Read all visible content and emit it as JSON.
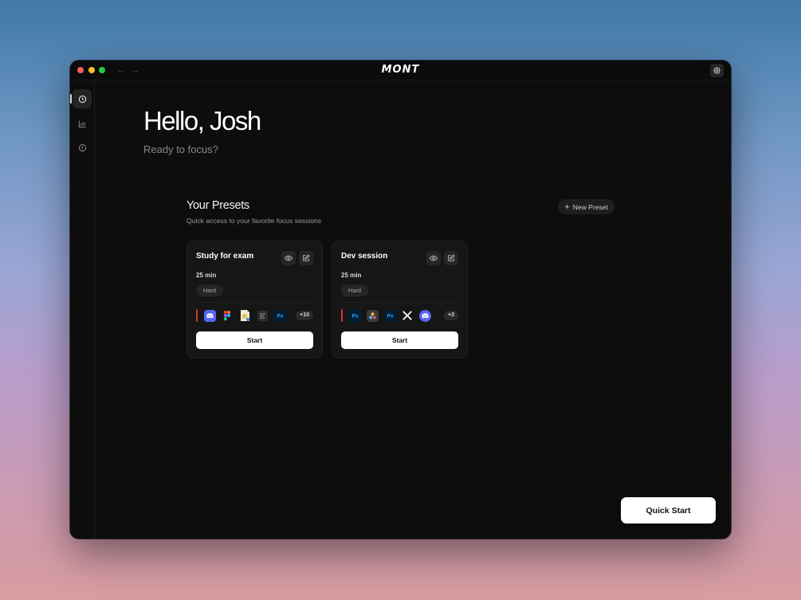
{
  "window": {
    "brand": "MONT",
    "traffic_lights": [
      "#fe5f57",
      "#febc2e",
      "#28c840"
    ],
    "nav": {
      "back_icon": "arrow-left-icon",
      "forward_icon": "arrow-right-icon"
    },
    "settings_icon": "gear-icon"
  },
  "sidebar": {
    "items": [
      {
        "icon": "clock-icon",
        "active": true
      },
      {
        "icon": "bar-chart-icon",
        "active": false
      },
      {
        "icon": "history-icon",
        "active": false
      }
    ]
  },
  "main": {
    "greeting": "Hello, Josh",
    "subtitle": "Ready to focus?"
  },
  "presets": {
    "title": "Your Presets",
    "subtitle": "Quick access to your favorite focus sessions",
    "new_preset_label": "New Preset",
    "cards": [
      {
        "name": "Study for exam",
        "duration": "25 min",
        "difficulty": "Hard",
        "apps": [
          "discord-icon",
          "figma-icon",
          "document-icon",
          "notes-icon",
          "photoshop-icon"
        ],
        "more": "+10",
        "start_label": "Start"
      },
      {
        "name": "Dev session",
        "duration": "25 min",
        "difficulty": "Hard",
        "apps": [
          "photoshop-icon",
          "davinci-resolve-icon",
          "photoshop-icon",
          "x-icon",
          "discord-icon"
        ],
        "more": "+3",
        "start_label": "Start"
      }
    ]
  },
  "quick_start_label": "Quick Start",
  "colors": {
    "window_bg": "#0d0d0d",
    "card_bg": "#161616",
    "accent_red": "#c93a3a",
    "discord": "#5865f2",
    "photoshop": "#31a8ff"
  }
}
